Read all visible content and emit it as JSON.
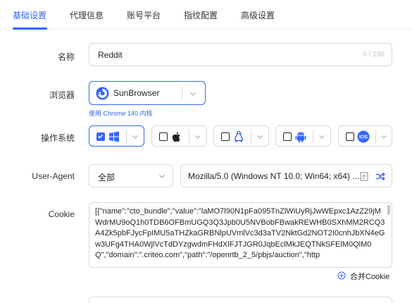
{
  "tabs": [
    {
      "label": "基础设置"
    },
    {
      "label": "代理信息"
    },
    {
      "label": "账号平台"
    },
    {
      "label": "指纹配置"
    },
    {
      "label": "高级设置"
    }
  ],
  "accent_color": "#3366ff",
  "name_field": {
    "label": "名称",
    "value": "Reddit",
    "counter": "6 / 100"
  },
  "browser": {
    "label": "浏览器",
    "selected": "SunBrowser",
    "icon": "sunbrowser-icon",
    "hint": "使用 Chrome 140 内核"
  },
  "os": {
    "label": "操作系统",
    "options": [
      {
        "icon": "windows-icon",
        "checked": true
      },
      {
        "icon": "apple-icon",
        "checked": false
      },
      {
        "icon": "linux-icon",
        "checked": false
      },
      {
        "icon": "android-icon",
        "checked": false
      },
      {
        "icon": "ios-icon",
        "checked": false
      }
    ]
  },
  "user_agent": {
    "label": "User-Agent",
    "filter": "全部",
    "value": "Mozilla/5.0 (Windows NT 10.0; Win64; x64) ..."
  },
  "cookie": {
    "label": "Cookie",
    "value": "[{\"name\":\"cto_bundle\",\"value\":\"laMO7l90N1pFa095TnZlWiUyRjJwWEpxc1AzZ29jMWdrMU9oQ1h0TDB6OFBmUGQ3Q3Jpb0U5NVBobFBwakREWHB0SXhMM2RCQ3A4Zk5pbFJycFpIMU5aTHZkaGRBNlpUVmlVc3d3aTV2NktGd2NOT2I0cnhJbXN4eGw3UFg4THA0WjlVcTdDYzgwdmFHdXlFJTJGR0JqbEclMkJEQTNkSFElM0QlM0Q\",\"domain\":\".criteo.com\",\"path\":\"/openrtb_2_5/pbjs/auction\",\"http",
    "merge_label": "合并Cookie"
  }
}
